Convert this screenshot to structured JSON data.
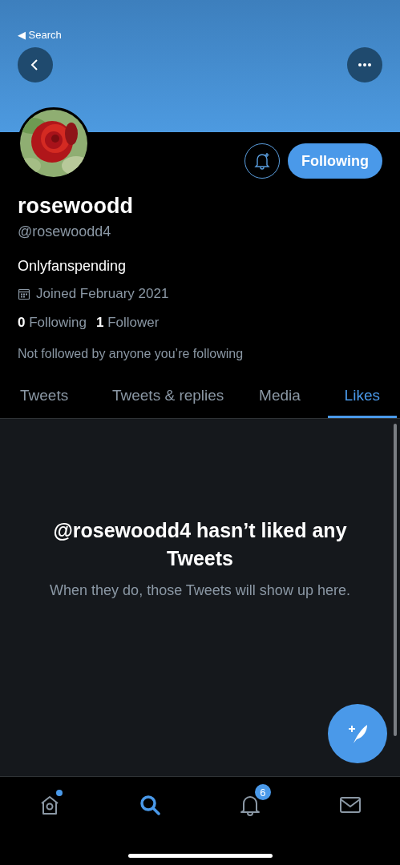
{
  "status_bar": {
    "back_label": "◀ Search"
  },
  "profile": {
    "name": "rosewoodd",
    "handle": "@rosewoodd4",
    "bio": "Onlyfanspending",
    "joined": "Joined February 2021",
    "following_count": "0",
    "following_label": "Following",
    "followers_count": "1",
    "followers_label": "Follower",
    "followed_by": "Not followed by anyone you’re following",
    "follow_button": "Following"
  },
  "tabs": [
    {
      "label": "Tweets",
      "selected": false
    },
    {
      "label": "Tweets & replies",
      "selected": false
    },
    {
      "label": "Media",
      "selected": false
    },
    {
      "label": "Likes",
      "selected": true
    }
  ],
  "empty_state": {
    "title": "@rosewoodd4 hasn’t liked any Tweets",
    "message": "When they do, those Tweets will show up here."
  },
  "bottom_nav": [
    {
      "kind": "home",
      "selected": false,
      "dot": true
    },
    {
      "kind": "search",
      "selected": true
    },
    {
      "kind": "notifications",
      "selected": false,
      "badge": "6"
    },
    {
      "kind": "messages",
      "selected": false
    }
  ]
}
